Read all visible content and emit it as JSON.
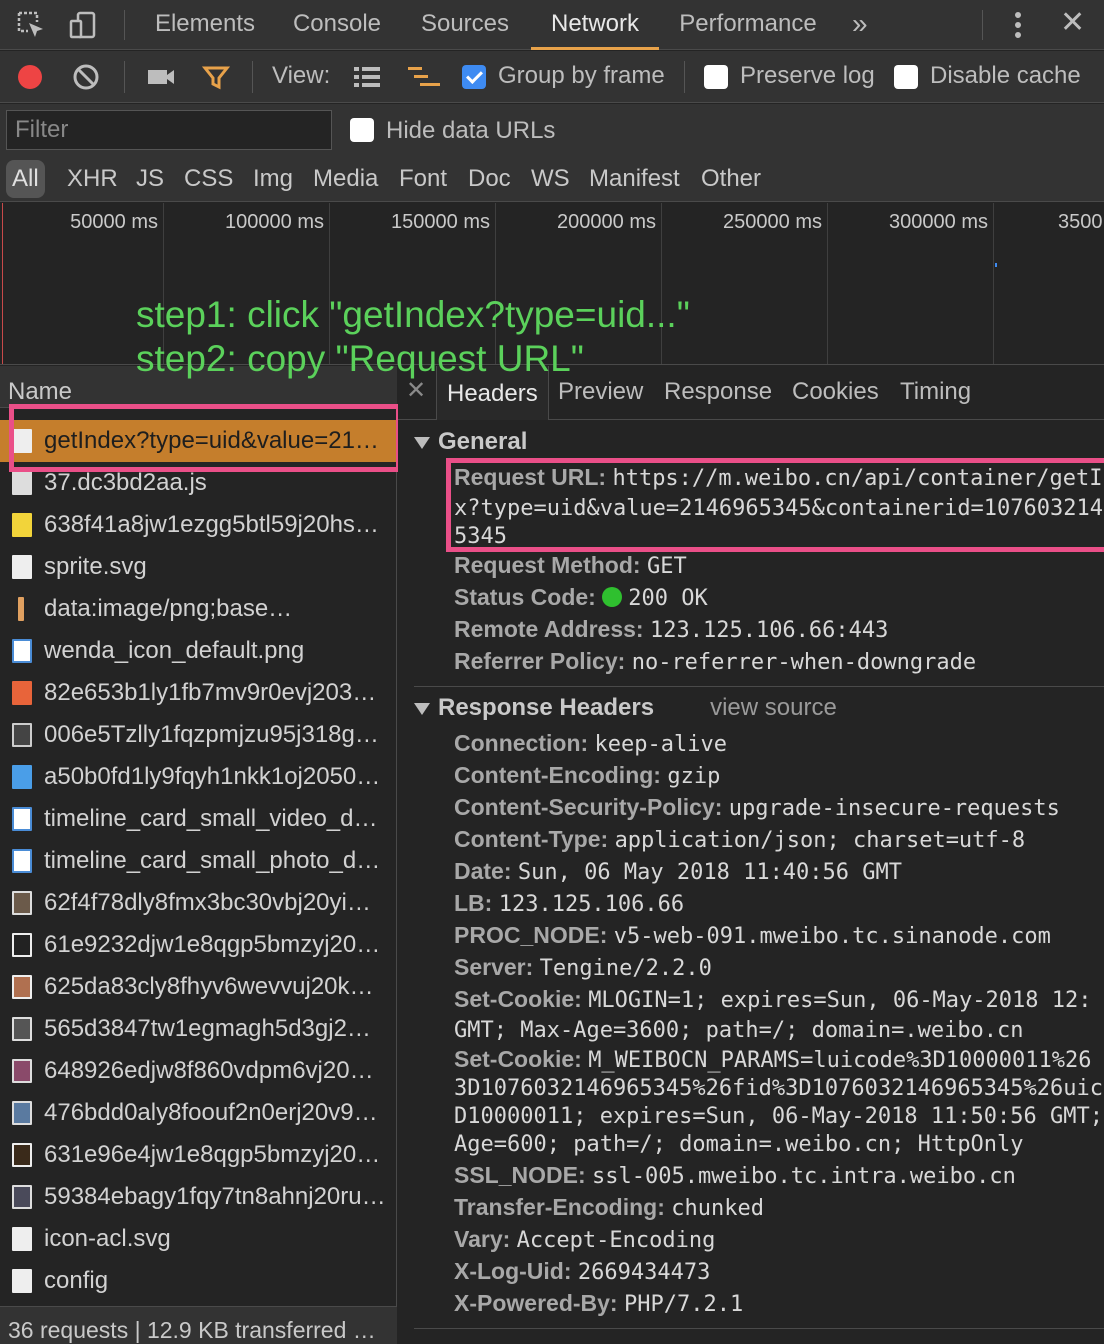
{
  "topbar": {
    "tabs": [
      "Elements",
      "Console",
      "Sources",
      "Network",
      "Performance"
    ],
    "active_tab": "Network",
    "more_glyph": "»",
    "close_glyph": "✕",
    "icons": [
      "inspect-icon",
      "device-toggle-icon",
      "kebab-menu-icon"
    ]
  },
  "toolbar": {
    "view_label": "View:",
    "group_by_frame_label": "Group by frame",
    "group_by_frame_checked": true,
    "preserve_log_label": "Preserve log",
    "preserve_log_checked": false,
    "disable_cache_label": "Disable cache",
    "disable_cache_checked": false,
    "record_color": "#ee4444",
    "filter_icon_color": "#e8a24a"
  },
  "filter": {
    "placeholder": "Filter",
    "hide_data_urls_label": "Hide data URLs",
    "hide_data_urls_checked": false
  },
  "types": [
    "All",
    "XHR",
    "JS",
    "CSS",
    "Img",
    "Media",
    "Font",
    "Doc",
    "WS",
    "Manifest",
    "Other"
  ],
  "overview": {
    "ticks": [
      "50000 ms",
      "100000 ms",
      "150000 ms",
      "200000 ms",
      "250000 ms",
      "300000 ms",
      "3500"
    ]
  },
  "annotation": {
    "step1": "step1: click \"getIndex?type=uid...\"",
    "step2": "step2: copy \"Request URL\"",
    "color": "#5bd15b",
    "highlight_color": "#ea4f88"
  },
  "requests": {
    "header": "Name",
    "items": [
      "getIndex?type=uid&value=21…",
      "37.dc3bd2aa.js",
      "638f41a8jw1ezgg5btl59j20hs…",
      "sprite.svg",
      "data:image/png;base…",
      "wenda_icon_default.png",
      "82e653b1ly1fb7mv9r0evj203…",
      "006e5Tzlly1fqzpmjzu95j318g…",
      "a50b0fd1ly9fqyh1nkk1oj2050…",
      "timeline_card_small_video_d…",
      "timeline_card_small_photo_d…",
      "62f4f78dly8fmx3bc30vbj20yi…",
      "61e9232djw1e8qgp5bmzyj20…",
      "625da83cly8fhyv6wevvuj20k…",
      "565d3847tw1egmagh5d3gj2…",
      "648926edjw8f860vdpm6vj20…",
      "476bdd0aly8foouf2n0erj20v9…",
      "631e96e4jw1e8qgp5bmzyj20…",
      "59384ebagy1fqy7tn8ahnj20ru…",
      "icon-acl.svg",
      "config"
    ],
    "selected_index": 0,
    "selected_color": "#c57e2c",
    "status": "36 requests | 12.9 KB transferred …"
  },
  "details": {
    "tabs": [
      "Headers",
      "Preview",
      "Response",
      "Cookies",
      "Timing"
    ],
    "active_tab": "Headers",
    "general_title": "General",
    "request_url_key": "Request URL:",
    "request_url_line1": "https://m.weibo.cn/api/container/getI",
    "request_url_line2": "x?type=uid&value=2146965345&containerid=107603214",
    "request_url_line3": "5345",
    "general": [
      {
        "k": "Request Method:",
        "v": "GET"
      },
      {
        "k": "Status Code:",
        "v": "200 OK"
      },
      {
        "k": "Remote Address:",
        "v": "123.125.106.66:443"
      },
      {
        "k": "Referrer Policy:",
        "v": "no-referrer-when-downgrade"
      }
    ],
    "status_dot_color": "#2fc02f",
    "response_headers_title": "Response Headers",
    "view_source": "view source",
    "response_headers": [
      {
        "k": "Connection:",
        "v": "keep-alive"
      },
      {
        "k": "Content-Encoding:",
        "v": "gzip"
      },
      {
        "k": "Content-Security-Policy:",
        "v": "upgrade-insecure-requests"
      },
      {
        "k": "Content-Type:",
        "v": "application/json; charset=utf-8"
      },
      {
        "k": "Date:",
        "v": "Sun, 06 May 2018 11:40:56 GMT"
      },
      {
        "k": "LB:",
        "v": "123.125.106.66"
      },
      {
        "k": "PROC_NODE:",
        "v": "v5-web-091.mweibo.tc.sinanode.com"
      },
      {
        "k": "Server:",
        "v": "Tengine/2.2.0"
      }
    ],
    "set_cookie_1_key": "Set-Cookie:",
    "set_cookie_1_line1": "MLOGIN=1; expires=Sun, 06-May-2018 12:",
    "set_cookie_1_line2": "GMT; Max-Age=3600; path=/; domain=.weibo.cn",
    "set_cookie_2_key": "Set-Cookie:",
    "set_cookie_2_line1": "M_WEIBOCN_PARAMS=luicode%3D10000011%26",
    "set_cookie_2_line2": "3D1076032146965345%26fid%3D1076032146965345%26uic",
    "set_cookie_2_line3": "D10000011; expires=Sun, 06-May-2018 11:50:56 GMT;",
    "set_cookie_2_line4": "Age=600; path=/; domain=.weibo.cn; HttpOnly",
    "response_headers_tail": [
      {
        "k": "SSL_NODE:",
        "v": "ssl-005.mweibo.tc.intra.weibo.cn"
      },
      {
        "k": "Transfer-Encoding:",
        "v": "chunked"
      },
      {
        "k": "Vary:",
        "v": "Accept-Encoding"
      },
      {
        "k": "X-Log-Uid:",
        "v": "2669434473"
      },
      {
        "k": "X-Powered-By:",
        "v": "PHP/7.2.1"
      }
    ]
  }
}
